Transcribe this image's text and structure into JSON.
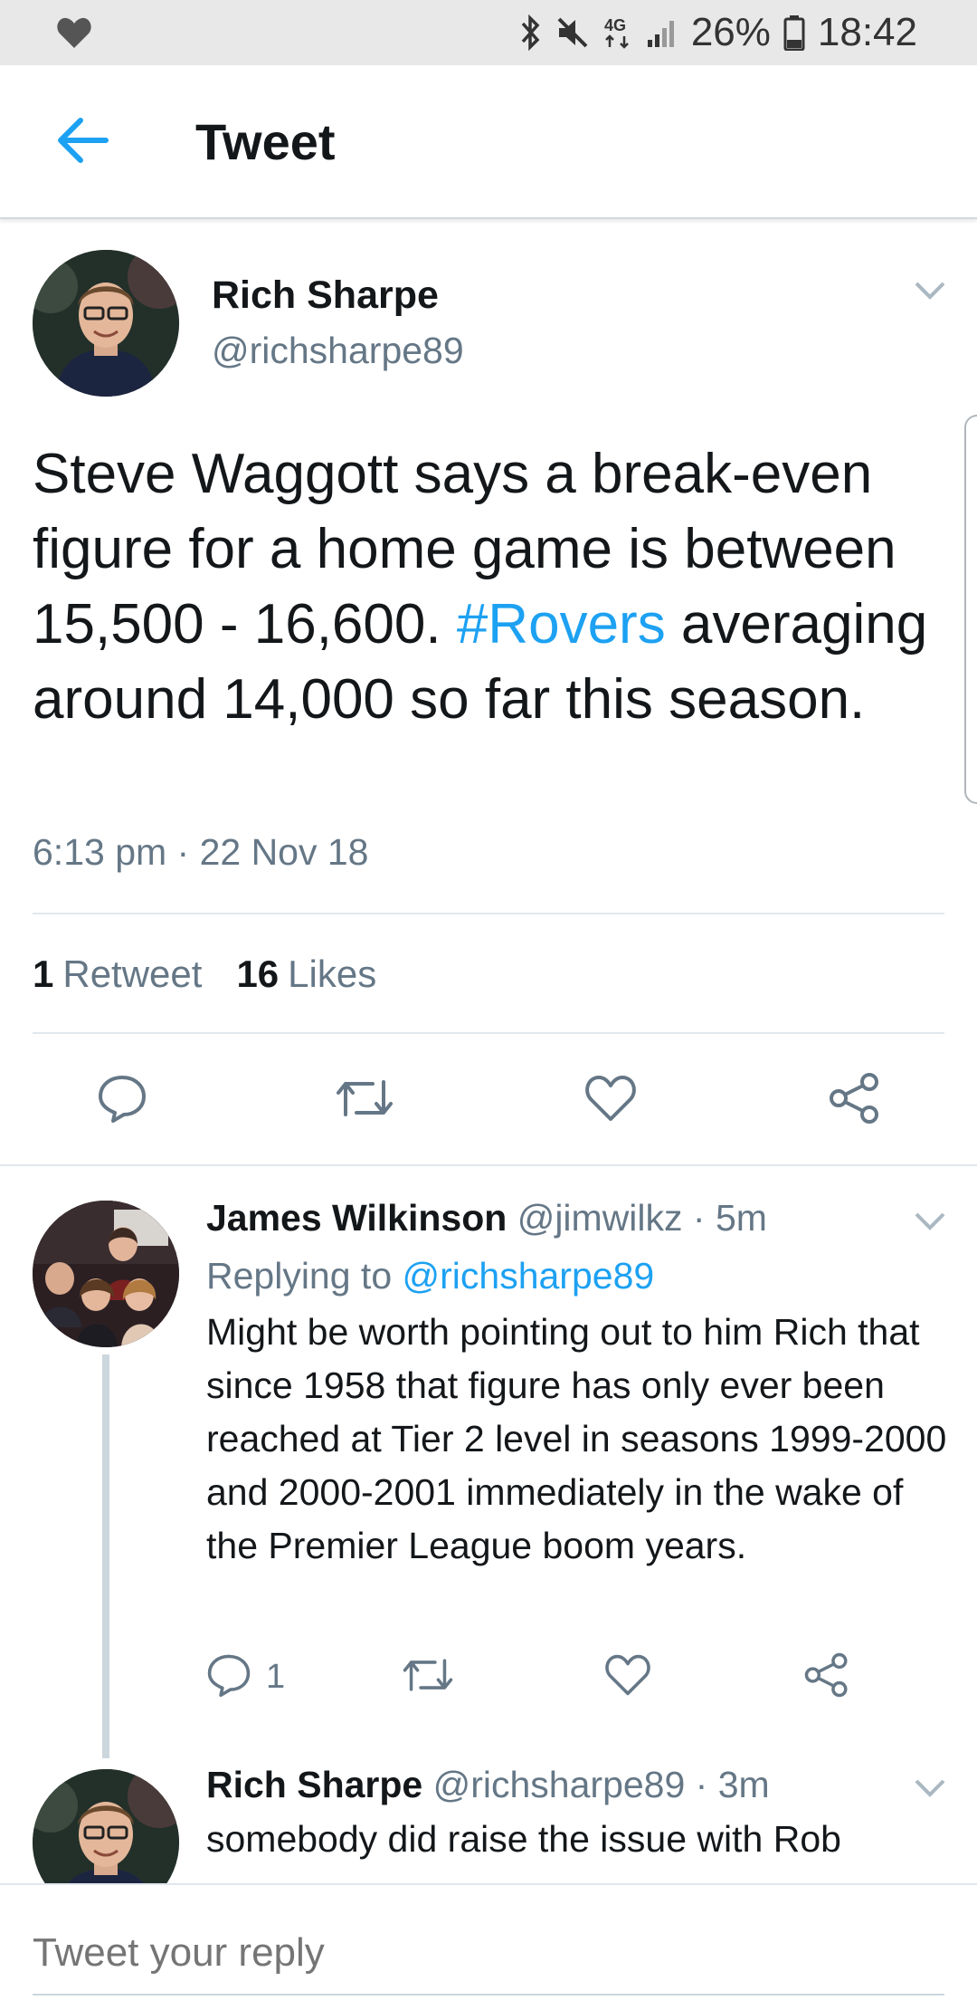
{
  "status_bar": {
    "battery": "26%",
    "time": "18:42",
    "network": "4G",
    "icons": [
      "heart-icon",
      "bluetooth-icon",
      "mute-icon",
      "network-4g-icon",
      "signal-icon",
      "battery-icon"
    ]
  },
  "header": {
    "title": "Tweet",
    "back_icon": "arrow-left-icon"
  },
  "tweet": {
    "author_name": "Rich Sharpe",
    "author_handle": "@richsharpe89",
    "text_before": "Steve Waggott says a break-even figure for a home game is between 15,500 - 16,600. ",
    "hashtag": "#Rovers",
    "text_after": " averaging around 14,000 so far this season.",
    "timestamp": "6:13 pm · 22 Nov 18",
    "retweet_count": "1",
    "retweet_label": "Retweet",
    "like_count": "16",
    "like_label": "Likes"
  },
  "replies": [
    {
      "author_name": "James Wilkinson",
      "meta": " @jimwilkz · 5m",
      "replying_prefix": "Replying to ",
      "replying_to": "@richsharpe89",
      "text": "Might be worth pointing out to him Rich that since 1958 that figure has only ever been reached at Tier 2 level in seasons 1999-2000 and 2000-2001 immediately in the wake of the Premier League boom years.",
      "reply_count": "1"
    },
    {
      "author_name": "Rich Sharpe",
      "meta": " @richsharpe89 · 3m",
      "text": "somebody did raise the issue with Rob"
    }
  ],
  "composer": {
    "placeholder": "Tweet your reply"
  },
  "colors": {
    "accent": "#1da1f2",
    "secondary_text": "#657786",
    "primary_text": "#14171a",
    "divider": "#e1e8ed"
  }
}
